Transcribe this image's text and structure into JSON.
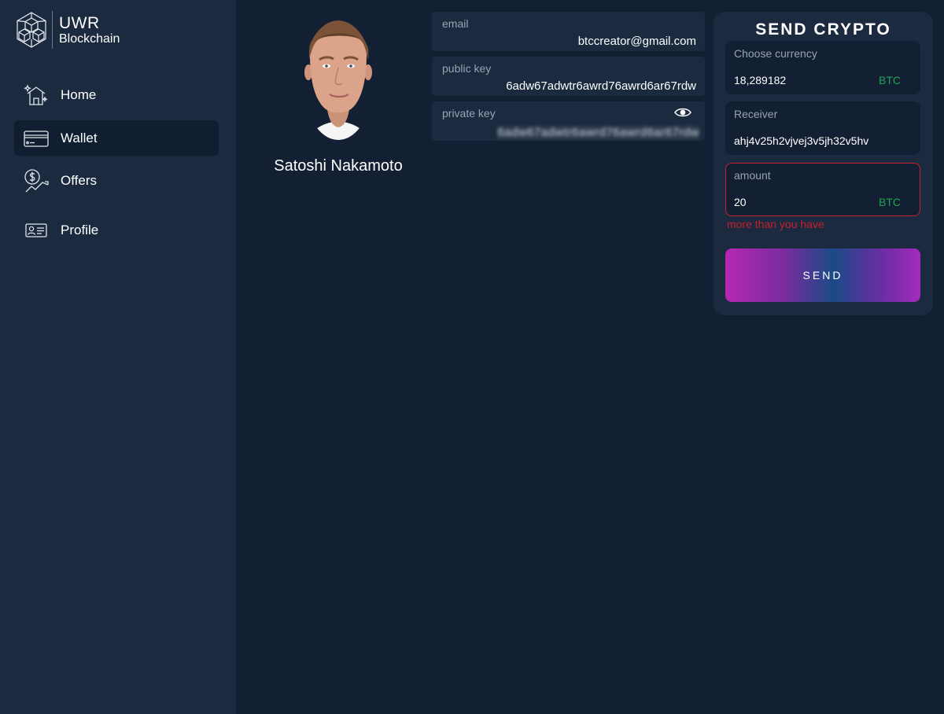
{
  "brand": {
    "title": "UWR",
    "subtitle": "Blockchain"
  },
  "sidebar": {
    "items": [
      {
        "label": "Home",
        "icon": "home-sparkle-icon",
        "active": false
      },
      {
        "label": "Wallet",
        "icon": "credit-card-icon",
        "active": true
      },
      {
        "label": "Offers",
        "icon": "dollar-chart-icon",
        "active": false
      },
      {
        "label": "Profile",
        "icon": "id-card-icon",
        "active": false
      }
    ]
  },
  "profile": {
    "name": "Satoshi Nakamoto"
  },
  "account": {
    "email_label": "email",
    "email": "btccreator@gmail.com",
    "public_key_label": "public key",
    "public_key": "6adw67adwtr6awrd76awrd6ar67rdw",
    "private_key_label": "private key",
    "private_key": "6adw67adwtr6awrd76awrd6ar67rdw"
  },
  "send": {
    "title": "SEND CRYPTO",
    "currency_label": "Choose currency",
    "currency_value": "18,289182",
    "currency_unit": "BTC",
    "receiver_label": "Receiver",
    "receiver_value": "ahj4v25h2vjvej3v5jh32v5hv",
    "amount_label": "amount",
    "amount_value": "20",
    "amount_unit": "BTC",
    "error_message": "more than you have",
    "button_label": "SEND"
  },
  "colors": {
    "background": "#132033",
    "panel": "#1b2a3e",
    "active_nav": "#111d31",
    "accent_green": "#1fa54c",
    "error_red": "#c4202e",
    "button_gradient_start": "#b627b3",
    "button_gradient_mid": "#1b4a86"
  }
}
